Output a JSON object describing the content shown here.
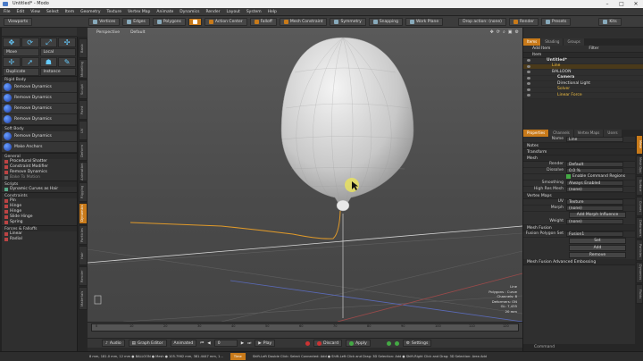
{
  "window": {
    "title": "Untitled* - Modo",
    "controls": [
      "–",
      "□",
      "✕"
    ]
  },
  "menu": [
    "File",
    "Edit",
    "View",
    "Select",
    "Item",
    "Geometry",
    "Texture",
    "Vertex Map",
    "Animate",
    "Dynamics",
    "Render",
    "Layout",
    "System",
    "Help"
  ],
  "toolbar": {
    "layout": "Viewports",
    "modes": [
      "Vertices",
      "Edges",
      "Polygons",
      "Items",
      "Materials",
      "Pivot",
      "Center"
    ],
    "buttons": [
      "Action Center",
      "Falloff",
      "Mesh Constraint",
      "Symmetry",
      "Snapping",
      "Work Plane"
    ],
    "drop_action": "Drop action: (none)",
    "right": [
      "Render",
      "Presets"
    ],
    "kits": "Kits"
  },
  "left": {
    "row1": [
      "Move",
      "Rotate",
      "Scale",
      "Transform"
    ],
    "row2": [
      "Local",
      "Element",
      "Select",
      "Action"
    ],
    "duplicate": "Duplicate",
    "instance": "Instance",
    "rigid_body": "Rigid Body",
    "rigid_tools": [
      "Remove Dynamics",
      "Remove Dynamics",
      "Remove Dynamics",
      "Remove Dynamics"
    ],
    "soft_body": "Soft Body",
    "soft_tools": [
      "Remove Dynamics",
      "Make Anchors"
    ],
    "general": "General",
    "general_items": [
      "Procedural Shatter",
      "Constraint Modifier",
      "Remove Dynamics",
      "Bake To Motion"
    ],
    "scripts": "Scripts",
    "script_items": [
      "Dynamic Curves as Hair"
    ],
    "constraints": "Constraints",
    "constraint_items": [
      "Pin",
      "Hinge",
      "Hinge",
      "Slide Hinge",
      "Spring"
    ],
    "forces": "Forces & Falloffs",
    "force_items": [
      "Linear",
      "Radial"
    ]
  },
  "vtabs": [
    "Basic",
    "Modeling",
    "Sculpt",
    "Paint",
    "UV",
    "Deform",
    "Animation",
    "Rigging",
    "Dynamics",
    "Particles",
    "Hair",
    "Render",
    "Materials"
  ],
  "viewport": {
    "view": "Perspective",
    "shading": "Default",
    "info": [
      "Line",
      "Polygons : Curve",
      "Channels: 8",
      "Deformers: ON",
      "GL: 7,435",
      "20 mm"
    ]
  },
  "timeline": {
    "ticks": [
      "0",
      "10",
      "20",
      "30",
      "40",
      "50",
      "60",
      "70",
      "80",
      "90",
      "100",
      "110",
      "120"
    ]
  },
  "playback": {
    "audio": "Audio",
    "graph": "Graph Editor",
    "animated": "Animated",
    "frame": "0",
    "play": "Play",
    "discard": "Discard",
    "apply": "Apply",
    "settings": "Settings"
  },
  "status": {
    "left": "8 mm, 181.0 mm, 12 mm ● BALLOON ● Mesh ● 105.7962 mm, 381.4447 mm, 1...",
    "time": "Time",
    "hint": "Shift-Left Double Click: Select Connected: Add ● Shift-Left Click and Drag: 3D Selection: Add ● Shift-Right Click and Drag: 3D Selection: Area Add"
  },
  "items": {
    "tabs": [
      "Items",
      "Shading",
      "Groups"
    ],
    "add_item": "Add Item",
    "filter": "Filter",
    "header": "Item",
    "rows": [
      {
        "name": "Untitled*",
        "indent": 0,
        "color": "#ddd"
      },
      {
        "name": "Line",
        "indent": 1,
        "color": "#f3c040"
      },
      {
        "name": "BALLOON",
        "indent": 1,
        "color": "#ddd"
      },
      {
        "name": "Camera",
        "indent": 2,
        "color": "#ddd"
      },
      {
        "name": "Directional Light",
        "indent": 2,
        "color": "#ddd"
      },
      {
        "name": "Solver",
        "indent": 2,
        "color": "#f3c040"
      },
      {
        "name": "Linear Force",
        "indent": 2,
        "color": "#f3c040"
      }
    ]
  },
  "props": {
    "tabs": [
      "Properties",
      "Channels",
      "Vertex Maps",
      "Users"
    ],
    "name_label": "Name",
    "name": "Line",
    "sections": [
      "Notes",
      "Transform",
      "Mesh"
    ],
    "render_label": "Render",
    "render": "Default",
    "dissolve_label": "Dissolve",
    "dissolve": "0.0 %",
    "enable_cmd": "Enable Command Regions",
    "smoothing_label": "Smoothing",
    "smoothing": "Always Enabled",
    "hires_label": "High Res Mesh",
    "hires": "(none)",
    "vmaps": "Vertex Maps",
    "uv_label": "UV",
    "uv": "Texture",
    "morph_label": "Morph",
    "morph": "(none)",
    "add_morph": "Add Morph Influence",
    "weight_label": "Weight",
    "weight": "(none)",
    "fusion": "Mesh Fusion",
    "fusion_poly_label": "Fusion Polygon Set",
    "fusion_poly": "Fusion1",
    "fusion_btns": [
      "Set",
      "Add",
      "Remove"
    ],
    "fusion_adv": "Mesh Fusion Advanced Embossing",
    "command": "Command"
  },
  "rvtabs": [
    "Mesh",
    "Mesh Ops",
    "Surface",
    "Curves",
    "Deformers",
    "Particles",
    "Dynamics",
    "Fluids"
  ]
}
